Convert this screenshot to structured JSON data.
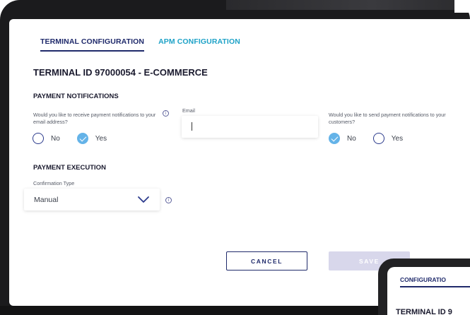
{
  "tabs": [
    {
      "label": "TERMINAL CONFIGURATION",
      "active": true
    },
    {
      "label": "APM CONFIGURATION",
      "active": false
    }
  ],
  "page_title": "TERMINAL ID 97000054 - E-COMMERCE",
  "payment_notifications": {
    "heading": "PAYMENT NOTIFICATIONS",
    "email_question": "Would you like to receive payment notifications to your email address?",
    "email_options": [
      {
        "label": "No",
        "checked": false
      },
      {
        "label": "Yes",
        "checked": true
      }
    ],
    "email_field_label": "Email",
    "email_field_value": "",
    "customer_question": "Would you like to send payment notifications to your customers?",
    "customer_options": [
      {
        "label": "No",
        "checked": true
      },
      {
        "label": "Yes",
        "checked": false
      }
    ]
  },
  "payment_execution": {
    "heading": "PAYMENT EXECUTION",
    "confirmation_label": "Confirmation Type",
    "confirmation_value": "Manual"
  },
  "buttons": {
    "cancel": "CANCEL",
    "save": "SAVE"
  },
  "inset": {
    "tab_label": "CONFIGURATIO",
    "title": "TERMINAL ID 9"
  },
  "colors": {
    "primary": "#1f2a6b",
    "accent_tab": "#1ea2c7",
    "radio_checked": "#64b3e8",
    "save_disabled": "#d8d7eb"
  },
  "icons": [
    "info-icon",
    "chevron-down-icon",
    "check-icon"
  ]
}
